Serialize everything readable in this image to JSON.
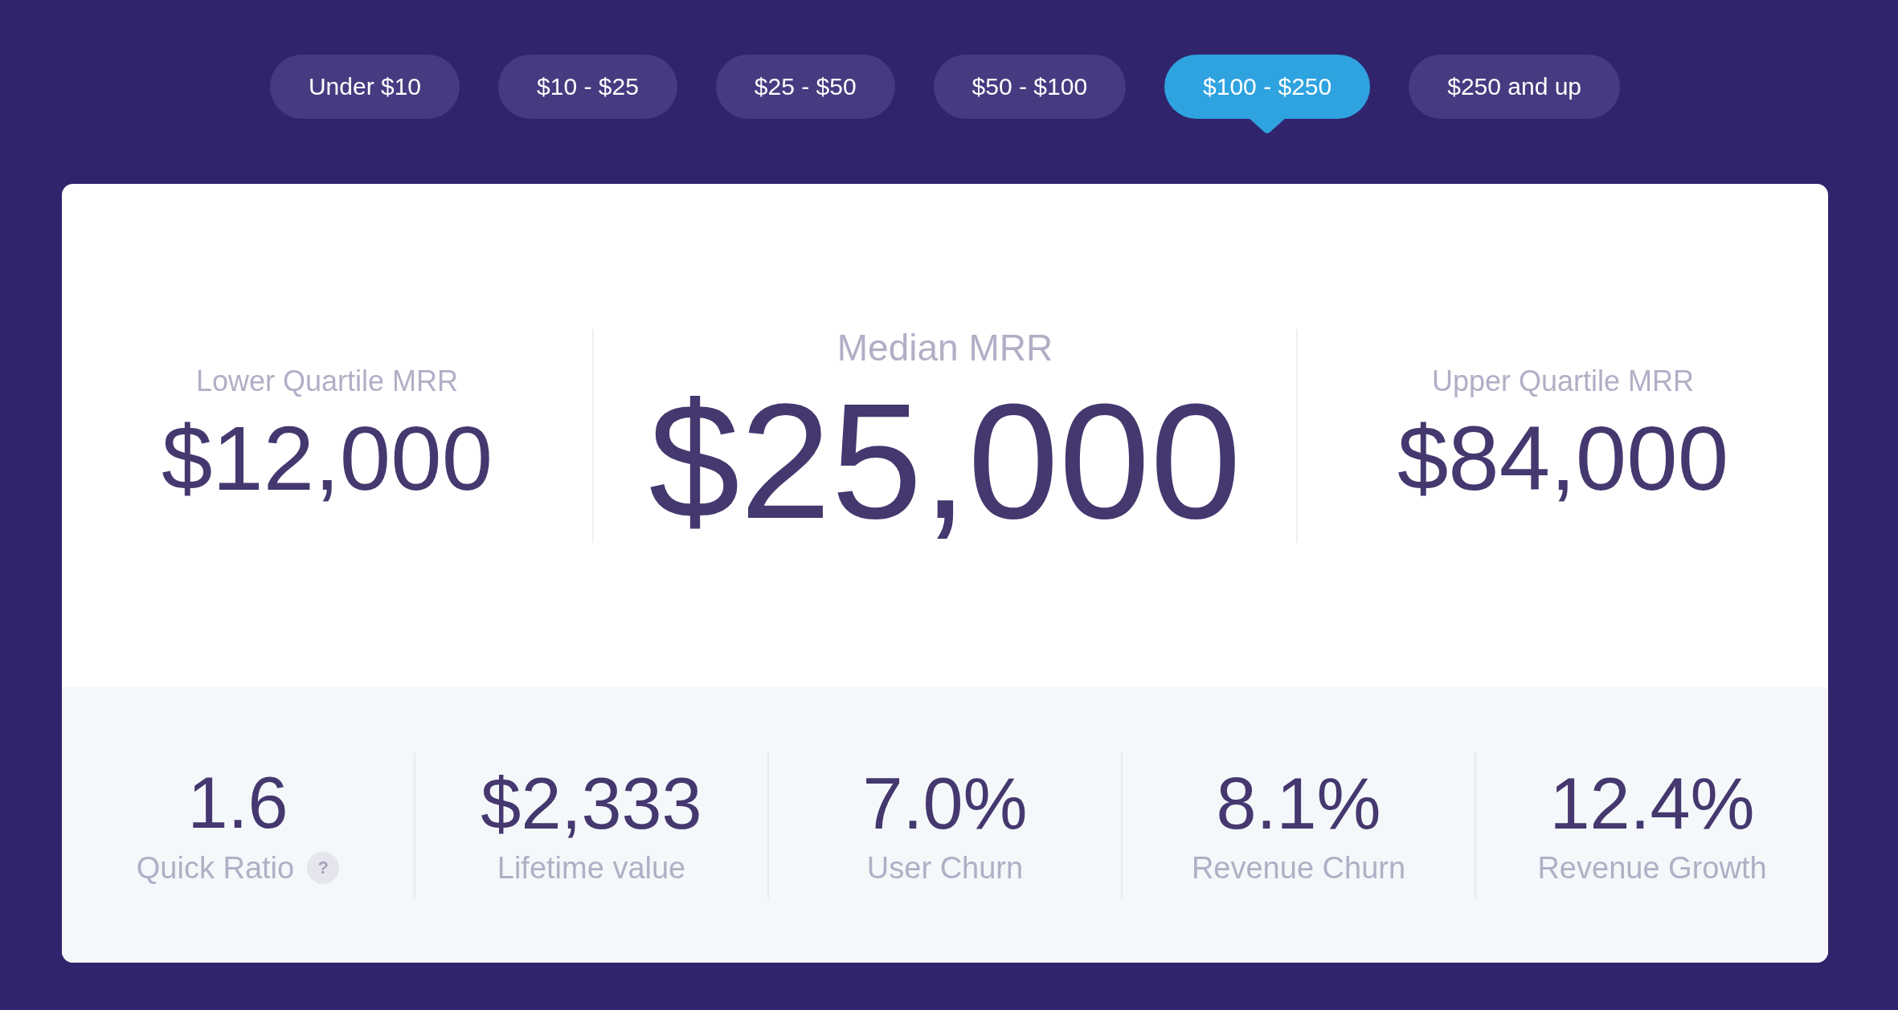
{
  "price_filters": [
    {
      "label": "Under $10",
      "selected": false
    },
    {
      "label": "$10 - $25",
      "selected": false
    },
    {
      "label": "$25 - $50",
      "selected": false
    },
    {
      "label": "$50 - $100",
      "selected": false
    },
    {
      "label": "$100 - $250",
      "selected": true
    },
    {
      "label": "$250 and up",
      "selected": false
    }
  ],
  "mrr": [
    {
      "kind": "quartile",
      "label": "Lower Quartile MRR",
      "value": "$12,000"
    },
    {
      "kind": "median",
      "label": "Median MRR",
      "value": "$25,000"
    },
    {
      "kind": "quartile",
      "label": "Upper Quartile MRR",
      "value": "$84,000"
    }
  ],
  "metrics": [
    {
      "value": "1.6",
      "label": "Quick Ratio",
      "help": "?"
    },
    {
      "value": "$2,333",
      "label": "Lifetime value"
    },
    {
      "value": "7.0%",
      "label": "User Churn"
    },
    {
      "value": "8.1%",
      "label": "Revenue Churn"
    },
    {
      "value": "12.4%",
      "label": "Revenue Growth"
    }
  ]
}
